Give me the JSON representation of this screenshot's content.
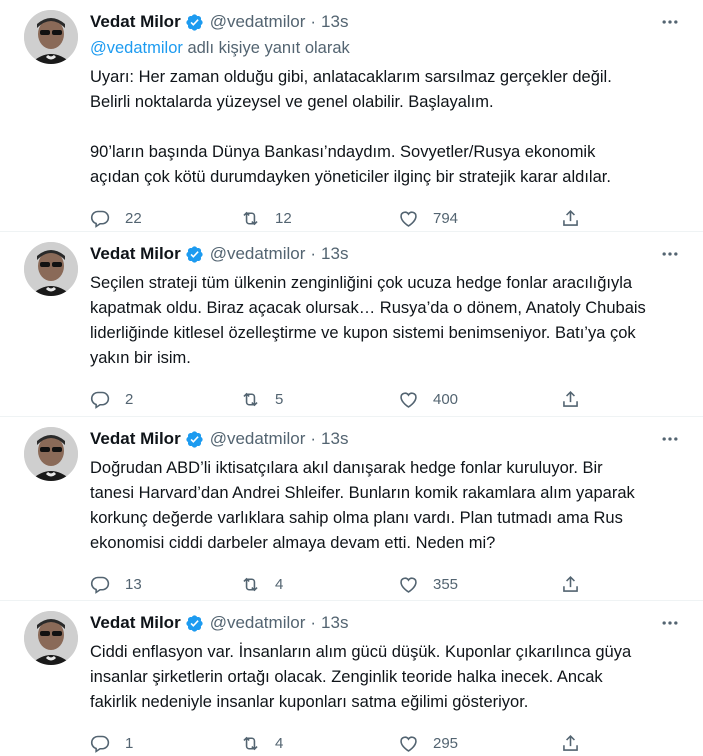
{
  "tweets": [
    {
      "name": "Vedat Milor",
      "handle": "@vedatmilor",
      "dot": "·",
      "time": "13s",
      "reply_mention": "@vedatmilor",
      "reply_suffix": " adlı kişiye yanıt olarak",
      "text": "Uyarı: Her zaman olduğu gibi, anlatacaklarım sarsılmaz gerçekler değil.\nBelirli noktalarda yüzeysel ve genel olabilir. Başlayalım.\n\n90’ların başında Dünya Bankası’ndaydım. Sovyetler/Rusya ekonomik\naçıdan çok kötü durumdayken yöneticiler ilginç bir stratejik karar aldılar.",
      "replies": "22",
      "retweets": "12",
      "likes": "794"
    },
    {
      "name": "Vedat Milor",
      "handle": "@vedatmilor",
      "dot": "·",
      "time": "13s",
      "text": "Seçilen strateji tüm ülkenin zenginliğini çok ucuza hedge fonlar aracılığıyla\nkapatmak oldu. Biraz açacak olursak… Rusya’da o dönem, Anatoly Chubais\nliderliğinde kitlesel özelleştirme ve kupon sistemi benimseniyor. Batı’ya çok\nyakın bir isim.",
      "replies": "2",
      "retweets": "5",
      "likes": "400"
    },
    {
      "name": "Vedat Milor",
      "handle": "@vedatmilor",
      "dot": "·",
      "time": "13s",
      "text": "Doğrudan ABD’li iktisatçılara akıl danışarak hedge fonlar kuruluyor. Bir\ntanesi Harvard’dan Andrei Shleifer. Bunların komik rakamlara alım yaparak\nkorkunç değerde varlıklara sahip olma planı vardı. Plan tutmadı ama Rus\nekonomisi ciddi darbeler almaya devam etti. Neden mi?",
      "replies": "13",
      "retweets": "4",
      "likes": "355"
    },
    {
      "name": "Vedat Milor",
      "handle": "@vedatmilor",
      "dot": "·",
      "time": "13s",
      "text": "Ciddi enflasyon var. İnsanların alım gücü düşük. Kuponlar çıkarılınca güya\ninsanlar şirketlerin ortağı olacak. Zenginlik teoride halka inecek. Ancak\nfakirlik nedeniyle insanlar kuponları satma eğilimi gösteriyor.",
      "replies": "1",
      "retweets": "4",
      "likes": "295"
    }
  ],
  "icons": {
    "verified": "verified-badge-icon",
    "more": "more-options-icon",
    "reply": "reply-icon",
    "retweet": "retweet-icon",
    "like": "heart-icon",
    "share": "share-icon"
  },
  "colors": {
    "text": "#0f1419",
    "secondary": "#536471",
    "accent": "#1d9bf0",
    "divider": "#eff3f4"
  }
}
